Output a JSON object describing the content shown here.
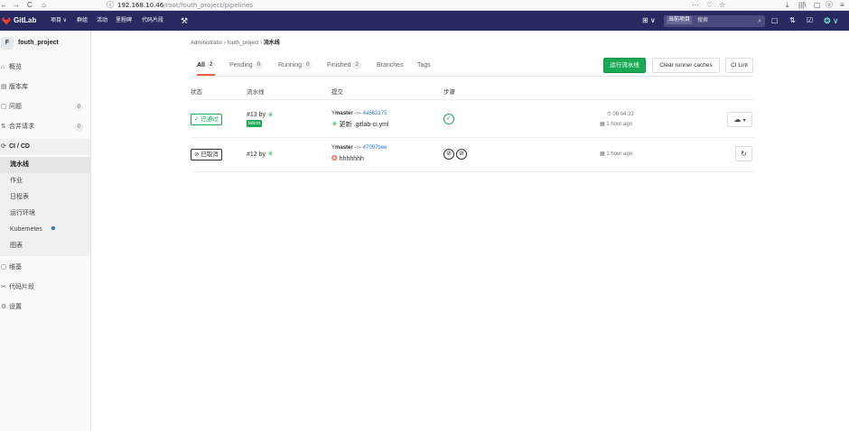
{
  "browser": {
    "url_host": "192.168.10.46",
    "url_path": "/root/fouth_project/pipelines",
    "left_icons": [
      "←",
      "→",
      "C",
      "⌂"
    ],
    "right_icons": [
      "···",
      "♡",
      "☆",
      "⤓",
      "|||\\",
      "▢",
      "ⓤ",
      "≡"
    ]
  },
  "topnav": {
    "brand": "GitLab",
    "menu": [
      "项目 ∨",
      "群组",
      "活动",
      "里程碑",
      "代码片段"
    ],
    "search_scope": "当前项目",
    "search_placeholder": "搜索"
  },
  "sidebar": {
    "project_initial": "F",
    "project_name": "fouth_project",
    "items": [
      {
        "label": "概览",
        "icon": "⌂"
      },
      {
        "label": "版本库",
        "icon": "▤"
      },
      {
        "label": "问题",
        "icon": "▢",
        "count": "0"
      },
      {
        "label": "合并请求",
        "icon": "⇅",
        "count": "0"
      },
      {
        "label": "CI / CD",
        "icon": "⟳"
      }
    ],
    "ci_sub": [
      {
        "label": "流水线"
      },
      {
        "label": "作业"
      },
      {
        "label": "日程表"
      },
      {
        "label": "运行环境"
      },
      {
        "label": "Kubernetes"
      },
      {
        "label": "图表"
      }
    ],
    "bottom": [
      {
        "label": "维基",
        "icon": "▢"
      },
      {
        "label": "代码片段",
        "icon": "✂"
      },
      {
        "label": "设置",
        "icon": "⚙"
      }
    ]
  },
  "breadcrumb": {
    "items": [
      "Administrator",
      "fouth_project"
    ],
    "current": "流水线",
    "separator": "›"
  },
  "tabs": [
    {
      "label": "All",
      "count": "2"
    },
    {
      "label": "Pending",
      "count": "0"
    },
    {
      "label": "Running",
      "count": "0"
    },
    {
      "label": "Finished",
      "count": "2"
    },
    {
      "label": "Branches"
    },
    {
      "label": "Tags"
    }
  ],
  "actions": {
    "run_pipeline": "运行流水线",
    "clear_caches": "Clear runner caches",
    "ci_lint": "CI Lint"
  },
  "table": {
    "headers": [
      "状态",
      "流水线",
      "提交",
      "步骤"
    ],
    "rows": [
      {
        "status": "已通过",
        "status_icon": "✓",
        "pipeline_id": "#13",
        "by": "by",
        "badge": "latest",
        "branch": "master",
        "sha": "4a562175",
        "commit_msg": "更新 .gitlab-ci.yml",
        "duration": "00:04:33",
        "finished": "1 hour ago"
      },
      {
        "status": "已取消",
        "status_icon": "⊘",
        "pipeline_id": "#12",
        "by": "by",
        "branch": "master",
        "sha": "47097bee",
        "commit_msg": "hhhhhhh",
        "finished": "1 hour ago"
      }
    ]
  },
  "colors": {
    "header": "#292961",
    "success": "#1aaa55",
    "link": "#1f78d1",
    "tab_accent": "#e75e40"
  }
}
